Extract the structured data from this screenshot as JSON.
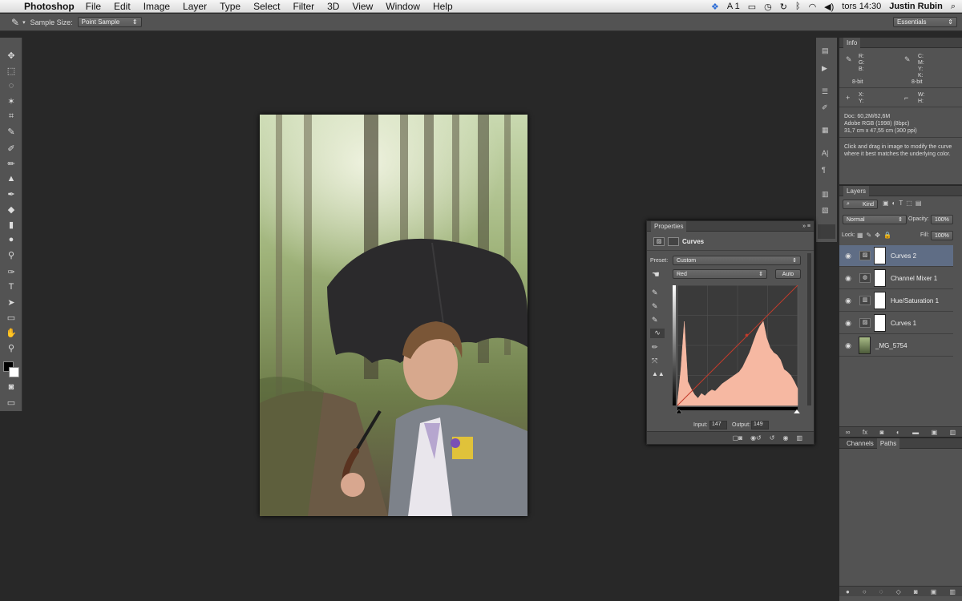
{
  "menubar": {
    "app_name": "Photoshop",
    "items": [
      "File",
      "Edit",
      "Image",
      "Layer",
      "Type",
      "Select",
      "Filter",
      "3D",
      "View",
      "Window",
      "Help"
    ],
    "status_a1": "A 1",
    "clock": "tors 14:30",
    "user": "Justin Rubin"
  },
  "options": {
    "sample_size_label": "Sample Size:",
    "sample_size_value": "Point Sample",
    "workspace": "Essentials"
  },
  "info": {
    "tab": "Info",
    "rgb_labels": [
      "R:",
      "G:",
      "B:"
    ],
    "cmyk_labels": [
      "C:",
      "M:",
      "Y:",
      "K:"
    ],
    "bit_left": "8-bit",
    "bit_right": "8-bit",
    "xy_labels": [
      "X:",
      "Y:"
    ],
    "wh_labels": [
      "W:",
      "H:"
    ],
    "doc": "Doc: 60,2M/62,6M",
    "profile": "Adobe RGB (1998) (8bpc)",
    "size": "31,7 cm x 47,55 cm (300 ppi)",
    "hint": "Click and drag in image to modify the curve where it best matches the underlying color."
  },
  "layers": {
    "tab": "Layers",
    "kind": "Kind",
    "blend": "Normal",
    "opacity_label": "Opacity:",
    "opacity": "100%",
    "lock_label": "Lock:",
    "fill_label": "Fill:",
    "fill": "100%",
    "rows": [
      {
        "name": "Curves 2",
        "selected": true
      },
      {
        "name": "Channel Mixer 1",
        "selected": false
      },
      {
        "name": "Hue/Saturation 1",
        "selected": false
      },
      {
        "name": "Curves 1",
        "selected": false
      },
      {
        "name": "_MG_5754",
        "selected": false
      }
    ],
    "fx": "fx"
  },
  "channels": {
    "tab_channels": "Channels",
    "tab_paths": "Paths"
  },
  "properties": {
    "tab": "Properties",
    "title": "Curves",
    "preset_label": "Preset:",
    "preset_value": "Custom",
    "channel": "Red",
    "auto": "Auto",
    "input_label": "Input:",
    "input_value": "147",
    "output_label": "Output:",
    "output_value": "149",
    "histogram": [
      2,
      30,
      70,
      20,
      14,
      9,
      6,
      10,
      8,
      11,
      13,
      12,
      15,
      18,
      20,
      22,
      24,
      26,
      28,
      32,
      38,
      44,
      52,
      60,
      66,
      70,
      56,
      48,
      44,
      42,
      38,
      30,
      28,
      25,
      20,
      14
    ],
    "curve_point": {
      "input": 147,
      "output": 149
    }
  },
  "colors": {
    "accent_curve": "#c23b2b",
    "histogram_fill": "#f6b8a2",
    "selected_row": "#5f6d85"
  }
}
